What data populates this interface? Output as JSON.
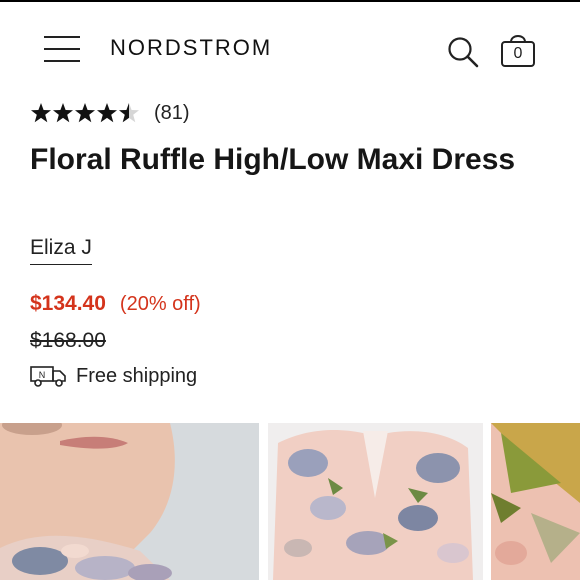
{
  "header": {
    "brand": "NORDSTROM",
    "menu_icon": "hamburger-menu-icon",
    "search_icon": "search-icon",
    "bag_icon": "shopping-bag-icon",
    "bag_count": "0"
  },
  "product": {
    "rating_stars": 4.5,
    "rating_max": 5,
    "review_count": "(81)",
    "title": "Floral Ruffle High/Low Maxi Dress",
    "brand_name": "Eliza J",
    "sale_price": "$134.40",
    "discount": "(20% off)",
    "original_price": "$168.00",
    "shipping_icon": "delivery-truck-icon",
    "shipping_badge": "N",
    "shipping_text": "Free shipping"
  },
  "gallery": {
    "images": [
      {
        "name": "model-close-up-photo"
      },
      {
        "name": "dress-front-photo"
      },
      {
        "name": "fabric-print-photo"
      }
    ]
  },
  "colors": {
    "sale": "#d4341c",
    "text": "#111111"
  }
}
